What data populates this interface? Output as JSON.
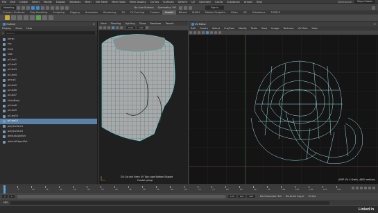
{
  "menubar": {
    "items": [
      "File",
      "Edit",
      "Create",
      "Select",
      "Modify",
      "Display",
      "Windows",
      "Mesh",
      "Edit Mesh",
      "Mesh Tools",
      "Mesh Display",
      "Curves",
      "Surfaces",
      "Deform",
      "UV",
      "Generate",
      "Cache",
      "Substance",
      "Arnold",
      "Help"
    ],
    "workspace": "Maya Classic"
  },
  "status": {
    "mode": "Modeling",
    "no_live": "No Live Surface",
    "symmetry": "Symmetry: Off",
    "sign_in": "Sign In"
  },
  "shelf": {
    "tabs": [
      "Curves / Surfaces",
      "Poly Modeling",
      "Sculpting",
      "Rigging",
      "Animation",
      "Rendering",
      "FX",
      "FX Caching",
      "Custom",
      "Arnold",
      "Bifrost",
      "MASH",
      "Motion Graphics",
      "XGen",
      "VR",
      "Substance",
      "TURTLE"
    ],
    "active_index": 9
  },
  "outliner": {
    "title": "Outliner",
    "menu": [
      "Display",
      "Show",
      "Help"
    ],
    "search_placeholder": "Search...",
    "items": [
      {
        "label": "persp",
        "selected": false
      },
      {
        "label": "top",
        "selected": false
      },
      {
        "label": "front",
        "selected": false
      },
      {
        "label": "side",
        "selected": false
      },
      {
        "label": "pCube1",
        "selected": false
      },
      {
        "label": "pCube2",
        "selected": false
      },
      {
        "label": "pCube3",
        "selected": false
      },
      {
        "label": "pCube4",
        "selected": false
      },
      {
        "label": "group1",
        "selected": false
      },
      {
        "label": "pCube5",
        "selected": false
      },
      {
        "label": "pCube6",
        "selected": false
      },
      {
        "label": "pCube7",
        "selected": false
      },
      {
        "label": "HelmBody",
        "selected": false
      },
      {
        "label": "pCube8",
        "selected": false
      },
      {
        "label": "pCube9",
        "selected": false
      },
      {
        "label": "pCube10",
        "selected": false
      },
      {
        "label": "pCube11",
        "selected": true
      },
      {
        "label": "polySurface1",
        "selected": false
      },
      {
        "label": "polySurface2",
        "selected": false
      },
      {
        "label": "defaultLightSet",
        "selected": false
      },
      {
        "label": "defaultObjectSet",
        "selected": false
      }
    ]
  },
  "viewport_left": {
    "menu": [
      "View",
      "Shading",
      "Lighting",
      "Show",
      "Renderer",
      "Panels"
    ],
    "camera": "persp",
    "coords": "0.00",
    "scale": "1.00",
    "hud_line1": "DX Cut and Sewn UV Tool: pipe Bottom Shaped",
    "hud_line2": "Frontal: persp"
  },
  "viewport_right": {
    "title": "UV Editor",
    "menu": [
      "Edit",
      "Create",
      "Select",
      "Cut/Sew",
      "Modify",
      "Tools",
      "View",
      "Image",
      "Textures",
      "UV Sets",
      "Help"
    ],
    "uv_readout": "UV coordinates: 0.0000 0.0000",
    "hud": "(MSP UV: 4 Shells, 4892 vertices)"
  },
  "timeline": {
    "ticks": [
      "0",
      "5",
      "10",
      "15",
      "20",
      "25",
      "30",
      "35",
      "40",
      "45",
      "50",
      "55",
      "60",
      "65",
      "70",
      "75",
      "80",
      "85",
      "90",
      "95",
      "100",
      "105",
      "110",
      "115",
      "120"
    ],
    "current_frame": "1"
  },
  "range": {
    "start": "1",
    "start2": "1",
    "end": "120",
    "end2": "120",
    "fps": "200",
    "charset": "No Character Set",
    "anim_layer": "No Anim Layer",
    "fps_label": "24 fps"
  },
  "command": {
    "lang": "MEL",
    "value": ""
  },
  "watermark": "Linked in"
}
